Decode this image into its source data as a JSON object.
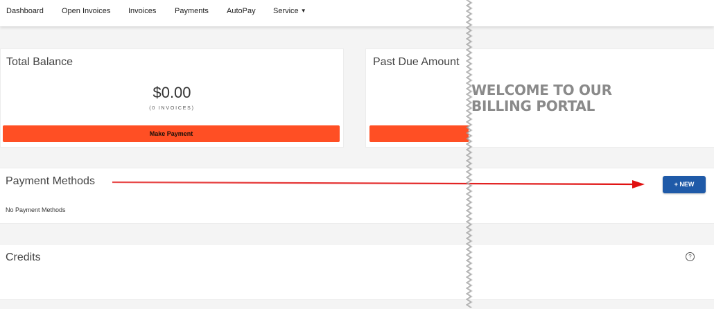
{
  "nav": {
    "items": [
      "Dashboard",
      "Open Invoices",
      "Invoices",
      "Payments",
      "AutoPay",
      "Service"
    ]
  },
  "total_balance": {
    "title": "Total Balance",
    "amount": "$0.00",
    "note": "(0 INVOICES)",
    "button": "Make Payment"
  },
  "past_due": {
    "title": "Past Due Amount"
  },
  "overlay": {
    "welcome_line1": "WELCOME TO OUR",
    "welcome_line2": "BILLING PORTAL"
  },
  "payment_methods": {
    "title": "Payment Methods",
    "new_button": "+ NEW",
    "empty_text": "No Payment Methods"
  },
  "credits": {
    "title": "Credits",
    "help_icon": "?"
  },
  "colors": {
    "accent_orange": "#ff4f24",
    "primary_blue": "#1f5aa8",
    "arrow_red": "#e01010",
    "welcome_gray": "#8a8a8a"
  }
}
